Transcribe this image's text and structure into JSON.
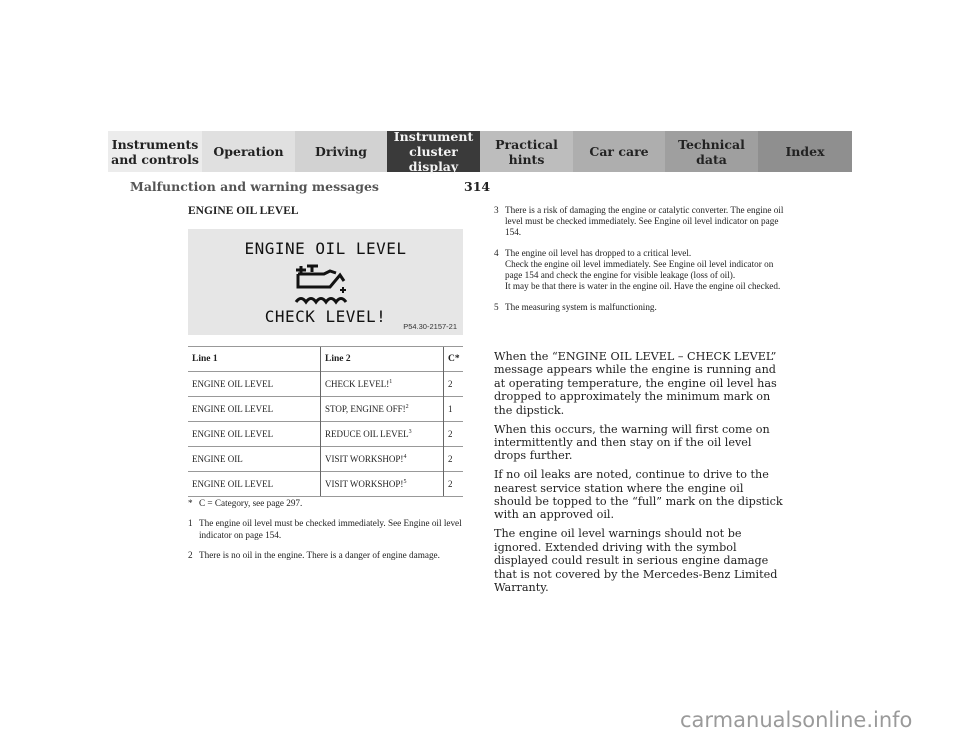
{
  "nav": {
    "tabs": [
      {
        "line1": "Instruments",
        "line2": "and controls",
        "active": false
      },
      {
        "line1": "Operation",
        "line2": "",
        "active": false
      },
      {
        "line1": "Driving",
        "line2": "",
        "active": false
      },
      {
        "line1": "Instrument",
        "line2": "cluster display",
        "active": true
      },
      {
        "line1": "Practical hints",
        "line2": "",
        "active": false
      },
      {
        "line1": "Car care",
        "line2": "",
        "active": false
      },
      {
        "line1": "Technical",
        "line2": "data",
        "active": false
      },
      {
        "line1": "Index",
        "line2": "",
        "active": false
      }
    ]
  },
  "header": {
    "section_title": "Malfunction and warning messages",
    "page_number": "314"
  },
  "main": {
    "heading": "ENGINE OIL LEVEL",
    "display": {
      "line1": "ENGINE OIL LEVEL",
      "line2": "CHECK LEVEL!",
      "icon": "engine-oil-can-icon",
      "figure_code": "P54.30-2157-21"
    },
    "table": {
      "headers": [
        "Line 1",
        "Line 2",
        "C*"
      ],
      "rows": [
        {
          "line1": "ENGINE OIL LEVEL",
          "line2": "CHECK LEVEL!",
          "note": "1",
          "c": "2"
        },
        {
          "line1": "ENGINE OIL LEVEL",
          "line2": "STOP, ENGINE OFF!",
          "note": "2",
          "c": "1"
        },
        {
          "line1": "ENGINE OIL LEVEL",
          "line2": "REDUCE OIL LEVEL",
          "note": "3",
          "c": "2"
        },
        {
          "line1": "ENGINE OIL",
          "line2": "VISIT WORKSHOP!",
          "note": "4",
          "c": "2"
        },
        {
          "line1": "ENGINE OIL LEVEL",
          "line2": "VISIT WORKSHOP!",
          "note": "5",
          "c": "2"
        }
      ]
    },
    "footnotes": [
      {
        "mark": "*",
        "text": "C = Category, see page 297."
      },
      {
        "mark": "1",
        "text": "The engine oil level must be checked immediately. See Engine oil level indicator on page 154."
      },
      {
        "mark": "2",
        "text": "There is no oil in the engine. There is a danger of engine damage."
      },
      {
        "mark": "3",
        "text": "There is a risk of damaging the engine or catalytic converter. The engine oil level must be checked immediately. See Engine oil level indicator on page 154."
      },
      {
        "mark": "4",
        "text": "The engine oil level has dropped to a critical level.\nCheck the engine oil level immediately. See Engine oil level indicator on page 154 and check the engine for visible leakage (loss of oil).\nIt may be that there is water in the engine oil. Have the engine oil checked."
      },
      {
        "mark": "5",
        "text": "The measuring system is malfunctioning."
      }
    ],
    "paragraphs": [
      "When the “ENGINE OIL LEVEL – CHECK LEVEL” message appears while the engine is running and at operating temperature, the engine oil level has dropped to approximately the minimum mark on the dipstick.",
      "When this occurs, the warning will first come on intermittently and then stay on if the oil level drops further.",
      "If no oil leaks are noted, continue to drive to the nearest service station where the engine oil should be topped to the “full” mark on the dipstick with an approved oil.",
      "The engine oil level warnings should not be ignored. Extended driving with the symbol displayed could result in serious engine damage that is not covered by the Mercedes-Benz Limited Warranty."
    ]
  },
  "watermark": "carmanualsonline.info"
}
